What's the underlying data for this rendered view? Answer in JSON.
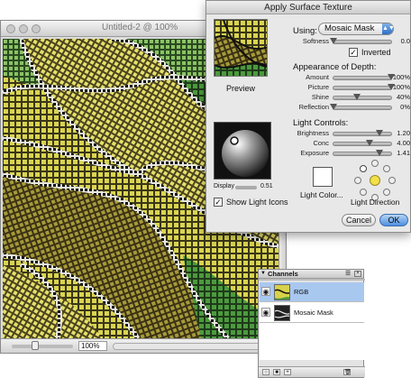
{
  "document": {
    "title": "Untitled-2 @ 100%",
    "zoom": "100%"
  },
  "dialog": {
    "title": "Apply Surface Texture",
    "preview_label": "Preview",
    "using_label": "Using:",
    "using_value": "Mosaic Mask",
    "softness_label": "Softness",
    "softness_value": "0.0",
    "softness_level": 0.0,
    "inverted_label": "Inverted",
    "inverted_checked": true,
    "depth_heading": "Appearance of Depth:",
    "depth": [
      {
        "name": "Amount",
        "value": "100%",
        "level": 1.0
      },
      {
        "name": "Picture",
        "value": "100%",
        "level": 1.0
      },
      {
        "name": "Shine",
        "value": "40%",
        "level": 0.4
      },
      {
        "name": "Reflection",
        "value": "0%",
        "level": 0.0
      }
    ],
    "light_heading": "Light Controls:",
    "lights": [
      {
        "name": "Brightness",
        "value": "1.20",
        "level": 0.8
      },
      {
        "name": "Conc",
        "value": "4.00",
        "level": 0.62
      },
      {
        "name": "Exposure",
        "value": "1.41",
        "level": 0.8
      }
    ],
    "display_label": "Display",
    "display_value": "0.51",
    "show_icons_label": "Show Light Icons",
    "show_icons_checked": true,
    "light_color_label": "Light Color...",
    "light_direction_label": "Light Direction",
    "cancel_label": "Cancel",
    "ok_label": "OK"
  },
  "channels": {
    "title": "Channels",
    "rows": [
      {
        "name": "RGB",
        "selected": true
      },
      {
        "name": "Mosaic Mask",
        "selected": false
      }
    ]
  },
  "colors": {
    "mosaic_yellow": "#d8d24a",
    "mosaic_black": "#111111",
    "mosaic_green": "#3f8f3a",
    "selection_blue": "#a9c8ef",
    "ok_blue": "#4d8fe0"
  }
}
